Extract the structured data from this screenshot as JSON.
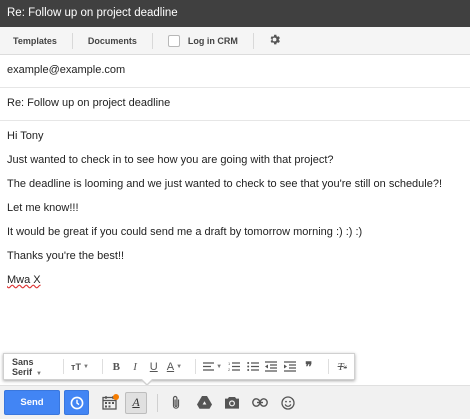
{
  "window": {
    "title": "Re: Follow up on project deadline"
  },
  "crm_toolbar": {
    "templates_label": "Templates",
    "documents_label": "Documents",
    "log_in_crm_label": "Log in CRM",
    "log_in_crm_checked": false,
    "settings_icon": "gear-icon"
  },
  "compose": {
    "to": "example@example.com",
    "subject": "Re: Follow up on project deadline",
    "body_lines": [
      "Hi Tony",
      "Just wanted to check in to see how you are going with that project?",
      "The deadline is looming and we just wanted to check to see that you're still on schedule?!",
      "Let me know!!!",
      "It would be great if you could send me a draft by tomorrow morning :) :) :)",
      "Thanks you're the best!!",
      "Mwa X"
    ]
  },
  "formatting": {
    "font_family": "Sans Serif",
    "icons": [
      "text-size-icon",
      "bold-icon",
      "italic-icon",
      "underline-icon",
      "text-color-icon",
      "align-icon",
      "numbered-list-icon",
      "bulleted-list-icon",
      "indent-less-icon",
      "indent-more-icon",
      "quote-icon",
      "clear-formatting-icon"
    ]
  },
  "bottom_toolbar": {
    "send_label": "Send",
    "accent_color": "#4285f4"
  }
}
